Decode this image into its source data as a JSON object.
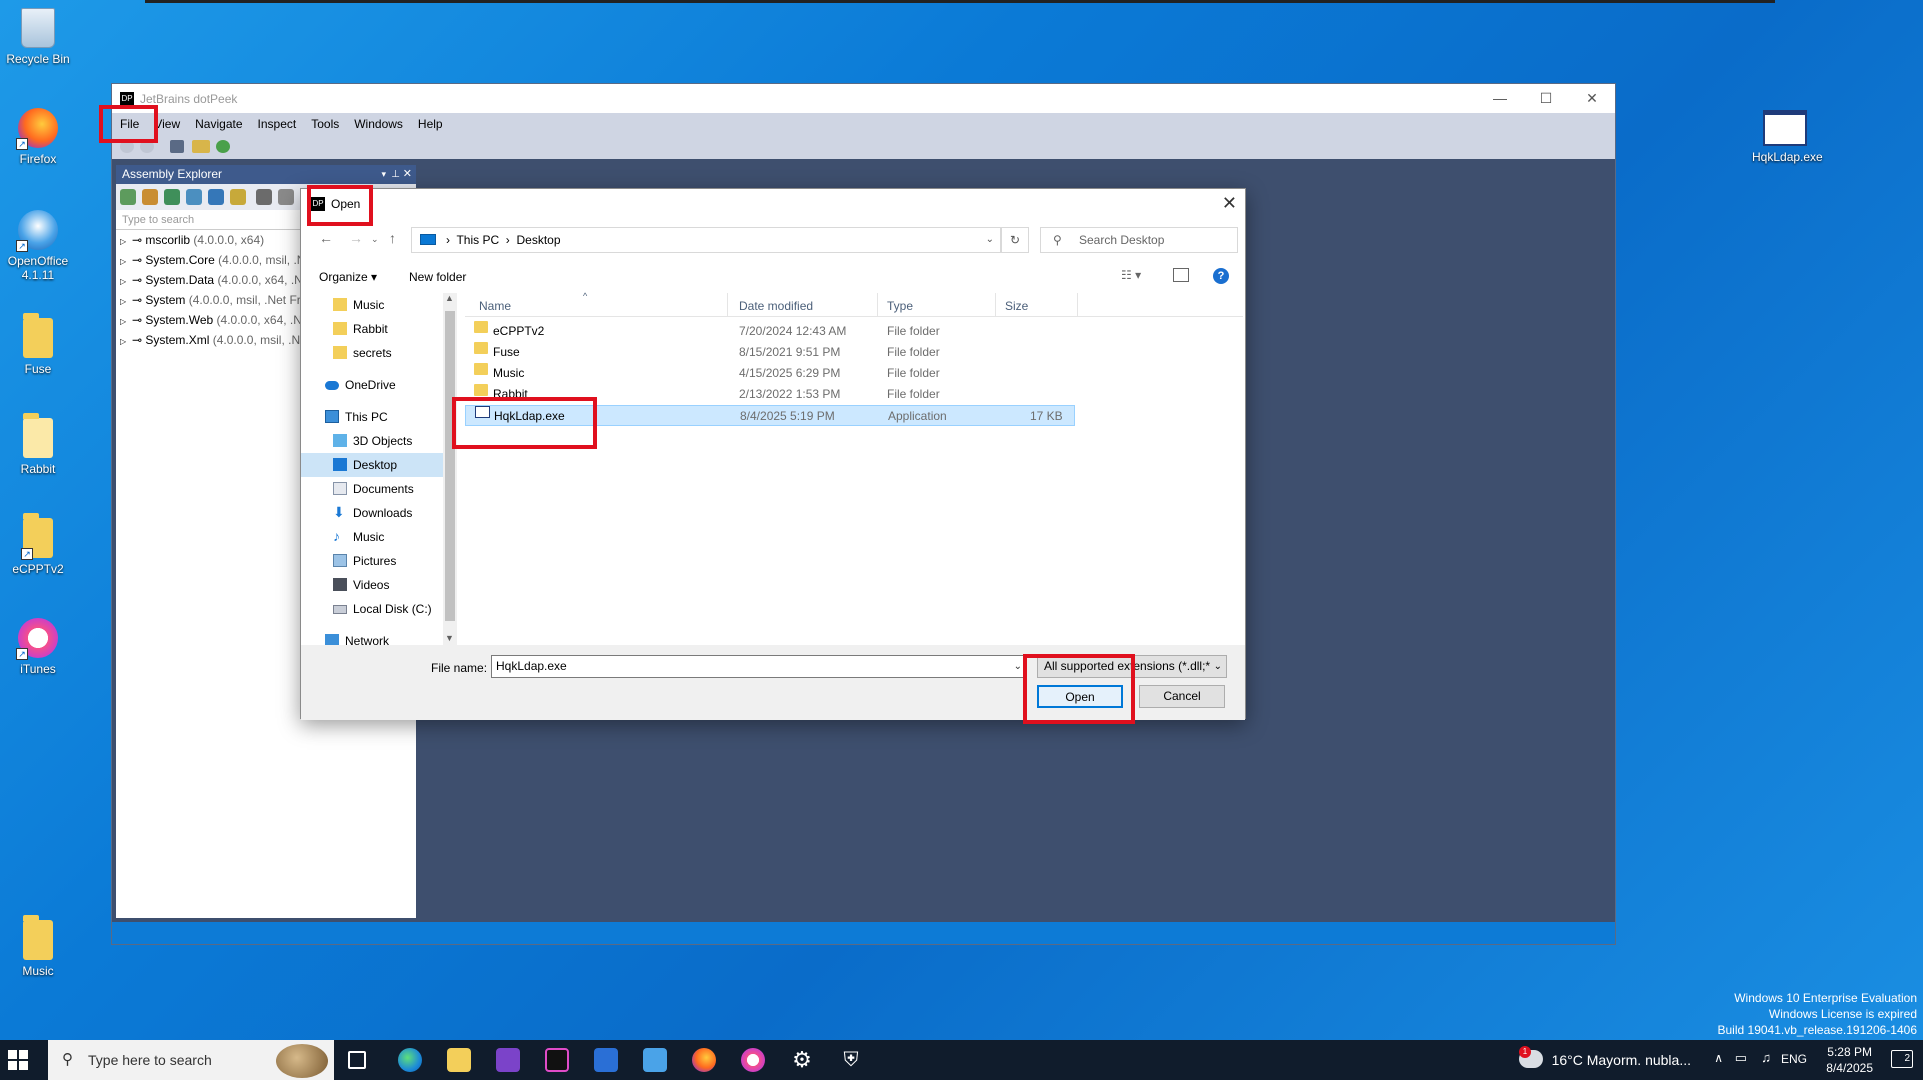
{
  "desktop": {
    "icons": [
      {
        "label": "Recycle Bin",
        "kind": "recycle"
      },
      {
        "label": "Firefox",
        "kind": "firefox"
      },
      {
        "label": "OpenOffice\n4.1.11",
        "kind": "openoffice"
      },
      {
        "label": "Fuse",
        "kind": "folder"
      },
      {
        "label": "Rabbit",
        "kind": "folder"
      },
      {
        "label": "eCPPTv2",
        "kind": "folder"
      },
      {
        "label": "iTunes",
        "kind": "itunes"
      },
      {
        "label": "Music",
        "kind": "folder"
      }
    ],
    "right_icon": {
      "label": "HqkLdap.exe"
    }
  },
  "dotpeek": {
    "title": "JetBrains dotPeek",
    "logo": "DP",
    "menu": [
      "File",
      "View",
      "Navigate",
      "Inspect",
      "Tools",
      "Windows",
      "Help"
    ],
    "assembly_explorer": {
      "title": "Assembly Explorer",
      "search_placeholder": "Type to search",
      "rows": [
        {
          "name": "mscorlib",
          "meta": "(4.0.0.0, x64)"
        },
        {
          "name": "System.Core",
          "meta": "(4.0.0.0, msil, .N"
        },
        {
          "name": "System.Data",
          "meta": "(4.0.0.0, x64, .N"
        },
        {
          "name": "System",
          "meta": "(4.0.0.0, msil, .Net Fr"
        },
        {
          "name": "System.Web",
          "meta": "(4.0.0.0, x64, .N"
        },
        {
          "name": "System.Xml",
          "meta": "(4.0.0.0, msil, .N"
        }
      ]
    }
  },
  "dialog": {
    "title": "Open",
    "close": "✕",
    "breadcrumb": [
      "This PC",
      "Desktop"
    ],
    "search_placeholder": "Search Desktop",
    "organize": "Organize ▾",
    "new_folder": "New folder",
    "nav_items": [
      {
        "label": "Music",
        "icon": "folder",
        "indent": 1
      },
      {
        "label": "Rabbit",
        "icon": "folder",
        "indent": 1
      },
      {
        "label": "secrets",
        "icon": "folder",
        "indent": 1
      },
      {
        "label": "OneDrive",
        "icon": "cloud",
        "indent": 0
      },
      {
        "label": "This PC",
        "icon": "pc",
        "indent": 0
      },
      {
        "label": "3D Objects",
        "icon": "cube",
        "indent": 1
      },
      {
        "label": "Desktop",
        "icon": "desktop",
        "indent": 1,
        "selected": true
      },
      {
        "label": "Documents",
        "icon": "doc",
        "indent": 1
      },
      {
        "label": "Downloads",
        "icon": "download",
        "indent": 1
      },
      {
        "label": "Music",
        "icon": "music",
        "indent": 1
      },
      {
        "label": "Pictures",
        "icon": "picture",
        "indent": 1
      },
      {
        "label": "Videos",
        "icon": "video",
        "indent": 1
      },
      {
        "label": "Local Disk (C:)",
        "icon": "disk",
        "indent": 1
      },
      {
        "label": "Network",
        "icon": "network",
        "indent": 0
      }
    ],
    "columns": {
      "name": "Name",
      "date": "Date modified",
      "type": "Type",
      "size": "Size"
    },
    "files": [
      {
        "name": "eCPPTv2",
        "date": "7/20/2024 12:43 AM",
        "type": "File folder",
        "size": "",
        "icon": "folder"
      },
      {
        "name": "Fuse",
        "date": "8/15/2021 9:51 PM",
        "type": "File folder",
        "size": "",
        "icon": "folder"
      },
      {
        "name": "Music",
        "date": "4/15/2025 6:29 PM",
        "type": "File folder",
        "size": "",
        "icon": "folder"
      },
      {
        "name": "Rabbit",
        "date": "2/13/2022 1:53 PM",
        "type": "File folder",
        "size": "",
        "icon": "folder"
      },
      {
        "name": "HqkLdap.exe",
        "date": "8/4/2025 5:19 PM",
        "type": "Application",
        "size": "17 KB",
        "icon": "exe",
        "selected": true
      }
    ],
    "file_name_label": "File name:",
    "file_name_value": "HqkLdap.exe",
    "filter": "All supported extensions (*.dll;*",
    "open_button": "Open",
    "cancel_button": "Cancel"
  },
  "taskbar": {
    "search_placeholder": "Type here to search",
    "weather": "16°C  Mayorm. nubla...",
    "weather_badge": "1",
    "lang": "ENG",
    "time": "5:28 PM",
    "date": "8/4/2025",
    "notif_count": "2"
  },
  "watermark": {
    "line1": "Windows 10 Enterprise Evaluation",
    "line2": "Windows License is expired",
    "line3": "Build 19041.vb_release.191206-1406"
  },
  "colors": {
    "accent": "#0078d7",
    "highlight": "#e0101e",
    "selection": "#cce8ff"
  }
}
